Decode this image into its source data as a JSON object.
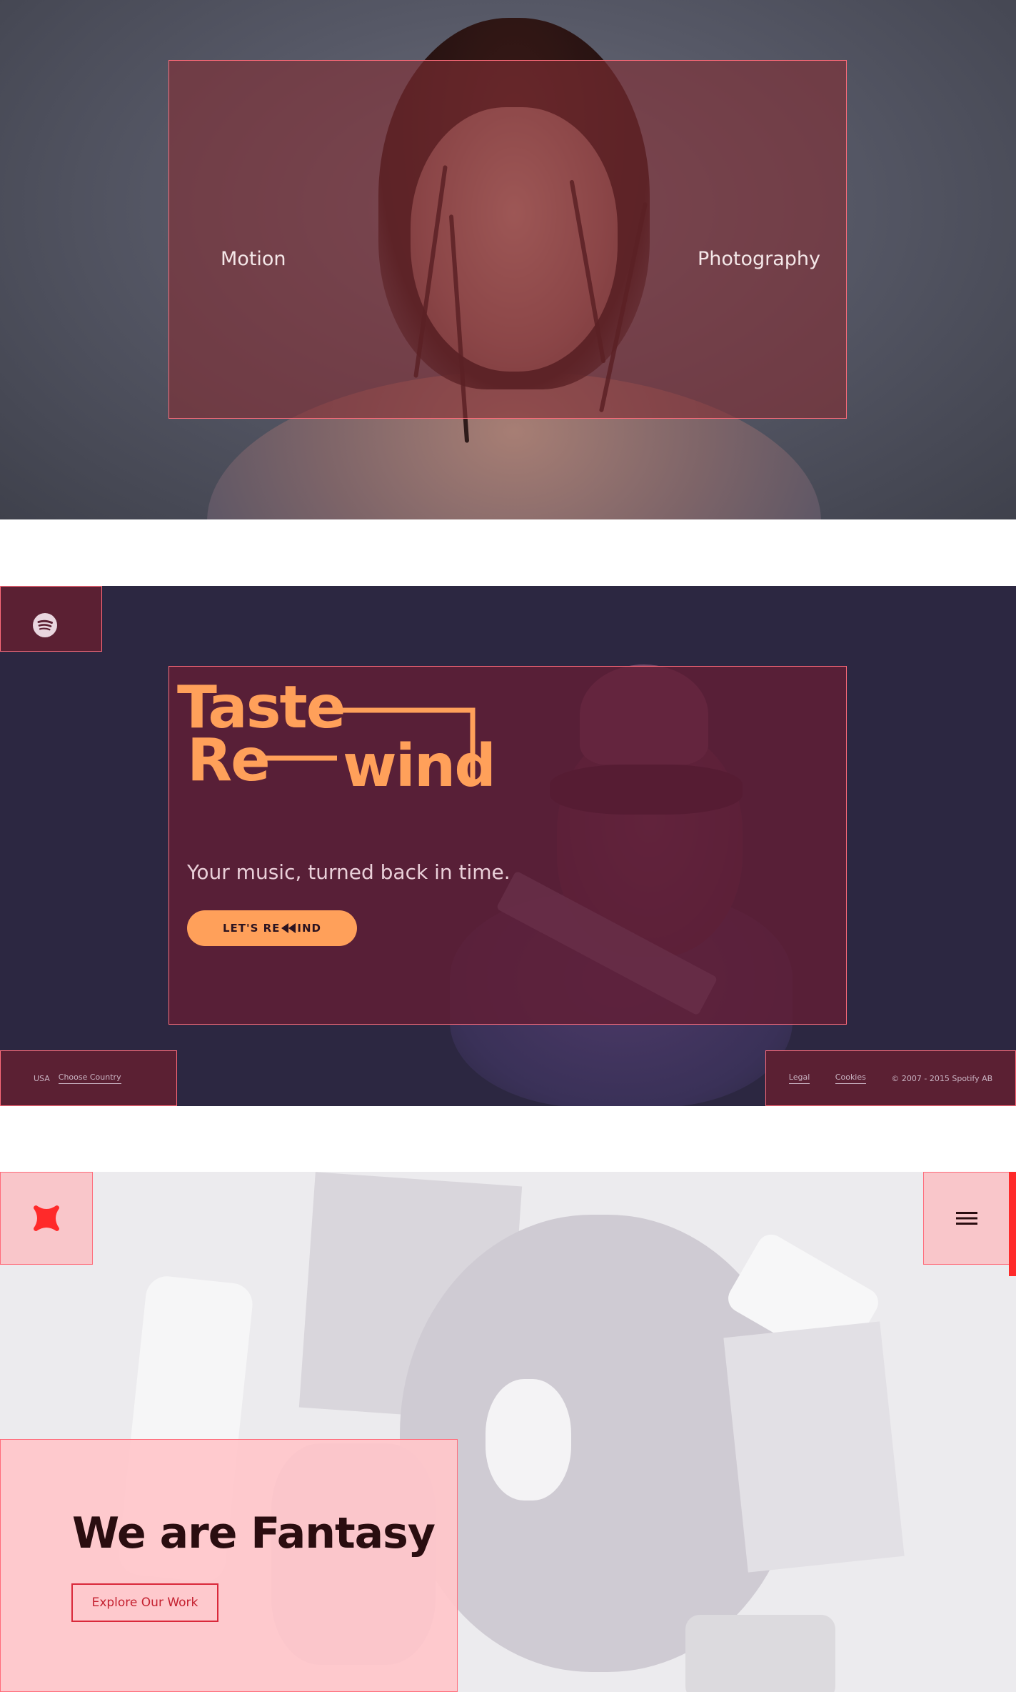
{
  "hero_motion": {
    "left_label": "Motion",
    "right_label": "Photography"
  },
  "spotify": {
    "logo_icon": "spotify-logo-icon",
    "headline_line1": "Taste",
    "headline_line2_part1": "Re",
    "headline_line2_part2": "wind",
    "tagline": "Your music, turned back in time.",
    "cta_prefix": "LET'S RE",
    "cta_icon": "rewind-icon",
    "cta_suffix": "IND",
    "footer": {
      "country": "USA",
      "choose_country": "Choose Country",
      "legal": "Legal",
      "cookies": "Cookies",
      "copyright": "© 2007 - 2015 Spotify AB"
    },
    "colors": {
      "accent": "#ffa05a",
      "background": "#2c2741",
      "card": "#601e36"
    }
  },
  "fantasy": {
    "logo_icon": "fantasy-logo-icon",
    "menu_icon": "hamburger-menu-icon",
    "headline": "We are Fantasy",
    "cta": "Explore Our Work",
    "colors": {
      "accent": "#ff2a2a",
      "panel": "#ffc6ca",
      "text": "#2a0d10"
    }
  }
}
